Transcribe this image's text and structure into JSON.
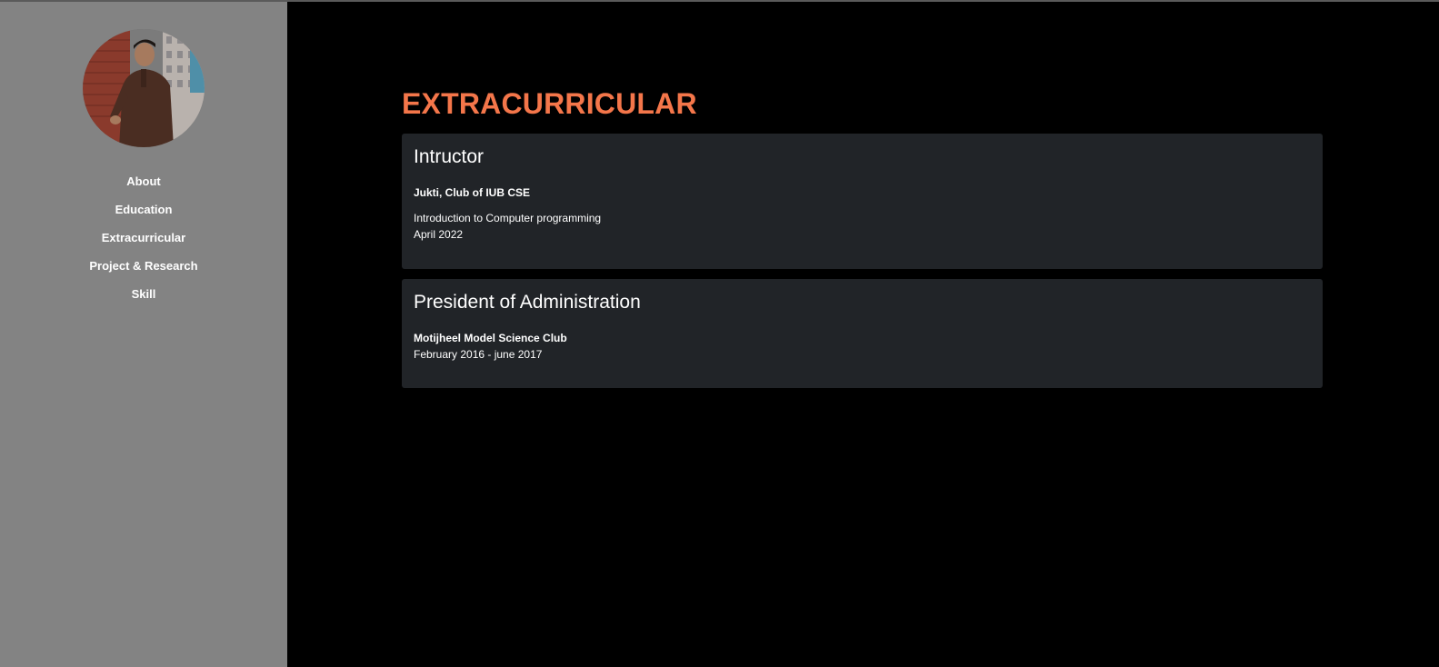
{
  "sidebar": {
    "nav": [
      {
        "label": "About"
      },
      {
        "label": "Education"
      },
      {
        "label": "Extracurricular"
      },
      {
        "label": "Project & Research"
      },
      {
        "label": "Skill"
      }
    ]
  },
  "main": {
    "section_title": "EXTRACURRICULAR",
    "cards": [
      {
        "role": "Intructor",
        "organization": "Jukti, Club of IUB CSE",
        "description": "Introduction to Computer programming",
        "date": "April 2022"
      },
      {
        "role": "President of Administration",
        "organization": "Motijheel Model Science Club",
        "date": "February 2016 - june 2017"
      }
    ]
  },
  "colors": {
    "sidebar_bg": "#838383",
    "main_bg": "#000000",
    "card_bg": "#212428",
    "accent": "#f4764a",
    "text": "#ffffff"
  }
}
